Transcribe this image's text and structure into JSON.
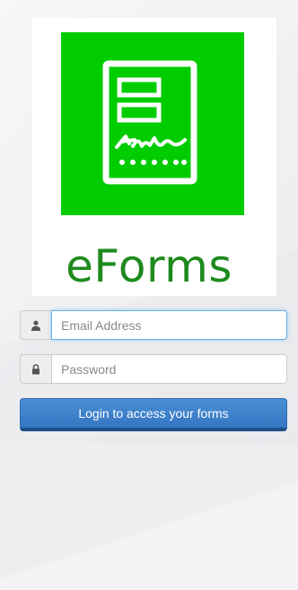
{
  "brand": {
    "name": "eForms",
    "logo_color": "#00cc00",
    "text_color": "#1e8a1e",
    "logo_icon": "signed-form-icon"
  },
  "login_form": {
    "email": {
      "icon": "user-icon",
      "placeholder": "Email Address",
      "value": ""
    },
    "password": {
      "icon": "lock-icon",
      "placeholder": "Password",
      "value": ""
    },
    "submit_label": "Login to access your forms",
    "accent_color": "#3a7fcb"
  }
}
